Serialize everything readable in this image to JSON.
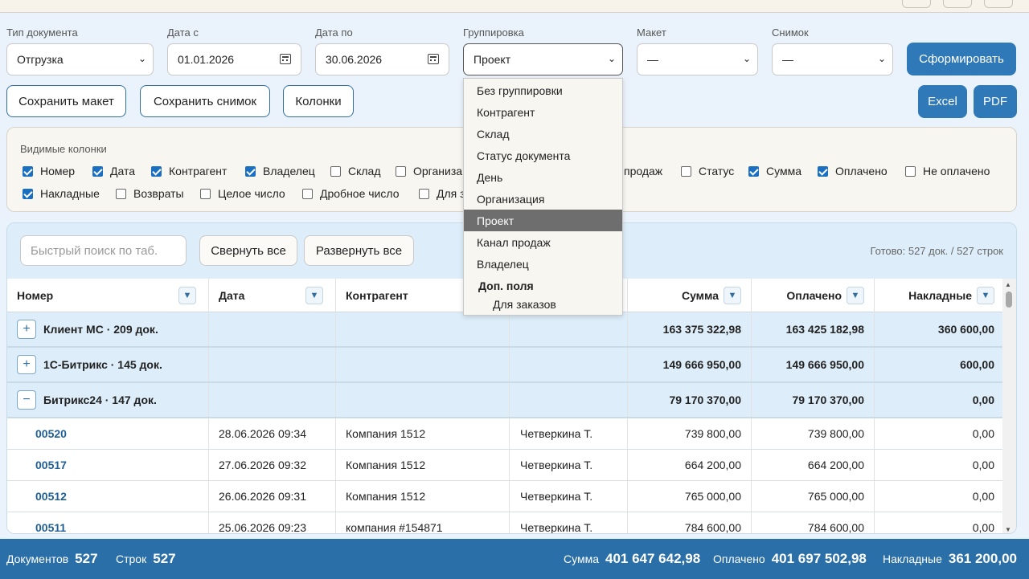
{
  "filters": {
    "doc_type": {
      "label": "Тип документа",
      "value": "Отгрузка"
    },
    "date_from": {
      "label": "Дата с",
      "value": "01.01.2026"
    },
    "date_to": {
      "label": "Дата по",
      "value": "30.06.2026"
    },
    "grouping": {
      "label": "Группировка",
      "value": "Проект"
    },
    "layout": {
      "label": "Макет",
      "value": "—"
    },
    "snapshot": {
      "label": "Снимок",
      "value": "—"
    },
    "generate_label": "Сформировать"
  },
  "actions": {
    "save_layout": "Сохранить макет",
    "save_snapshot": "Сохранить снимок",
    "columns": "Колонки",
    "excel": "Excel",
    "pdf": "PDF"
  },
  "columns_panel": {
    "title": "Видимые колонки",
    "items": [
      {
        "label": "Номер",
        "checked": true
      },
      {
        "label": "Дата",
        "checked": true
      },
      {
        "label": "Контрагент",
        "checked": true
      },
      {
        "label": "Владелец",
        "checked": true
      },
      {
        "label": "Склад",
        "checked": false
      },
      {
        "label": "Организа",
        "checked": false
      },
      {
        "label": "продаж",
        "checked": false
      },
      {
        "label": "Статус",
        "checked": false
      },
      {
        "label": "Сумма",
        "checked": true
      },
      {
        "label": "Оплачено",
        "checked": true
      },
      {
        "label": "Не оплачено",
        "checked": false
      },
      {
        "label": "Накладные",
        "checked": true
      },
      {
        "label": "Возвраты",
        "checked": false
      },
      {
        "label": "Целое число",
        "checked": false
      },
      {
        "label": "Дробное число",
        "checked": false
      },
      {
        "label": "Для з",
        "checked": false
      }
    ]
  },
  "grouping_dropdown": {
    "options": [
      "Без группировки",
      "Контрагент",
      "Склад",
      "Статус документа",
      "День",
      "Организация",
      "Проект",
      "Канал продаж",
      "Владелец"
    ],
    "selected": "Проект",
    "group_label": "Доп. поля",
    "group_options": [
      "Для заказов"
    ]
  },
  "table_toolbar": {
    "search_placeholder": "Быстрый поиск по таб.",
    "collapse_all": "Свернуть все",
    "expand_all": "Развернуть все",
    "status": "Готово: 527 док. / 527 строк"
  },
  "table": {
    "headers": {
      "number": "Номер",
      "date": "Дата",
      "counterparty": "Контрагент",
      "sum": "Сумма",
      "paid": "Оплачено",
      "invoices": "Накладные"
    },
    "filter_icon": "▼",
    "groups": [
      {
        "toggle": "+",
        "title": "Клиент МС · 209 док.",
        "sum": "163 375 322,98",
        "paid": "163 425 182,98",
        "invoices": "360 600,00"
      },
      {
        "toggle": "+",
        "title": "1С-Битрикс · 145 док.",
        "sum": "149 666 950,00",
        "paid": "149 666 950,00",
        "invoices": "600,00"
      },
      {
        "toggle": "−",
        "title": "Битрикс24 · 147 док.",
        "sum": "79 170 370,00",
        "paid": "79 170 370,00",
        "invoices": "0,00"
      }
    ],
    "rows": [
      {
        "number": "00520",
        "date": "28.06.2026 09:34",
        "counterparty": "Компания 1512",
        "owner": "Четверкина Т.",
        "sum": "739 800,00",
        "paid": "739 800,00",
        "invoices": "0,00"
      },
      {
        "number": "00517",
        "date": "27.06.2026 09:32",
        "counterparty": "Компания 1512",
        "owner": "Четверкина Т.",
        "sum": "664 200,00",
        "paid": "664 200,00",
        "invoices": "0,00"
      },
      {
        "number": "00512",
        "date": "26.06.2026 09:31",
        "counterparty": "Компания 1512",
        "owner": "Четверкина Т.",
        "sum": "765 000,00",
        "paid": "765 000,00",
        "invoices": "0,00"
      },
      {
        "number": "00511",
        "date": "25.06.2026 09:23",
        "counterparty": "компания #154871",
        "owner": "Четверкина Т.",
        "sum": "784 600,00",
        "paid": "784 600,00",
        "invoices": "0,00"
      }
    ]
  },
  "footer": {
    "docs_label": "Документов",
    "docs_value": "527",
    "rows_label": "Строк",
    "rows_value": "527",
    "sum_label": "Сумма",
    "sum_value": "401 647 642,98",
    "paid_label": "Оплачено",
    "paid_value": "401 697 502,98",
    "invoices_label": "Накладные",
    "invoices_value": "361 200,00"
  }
}
